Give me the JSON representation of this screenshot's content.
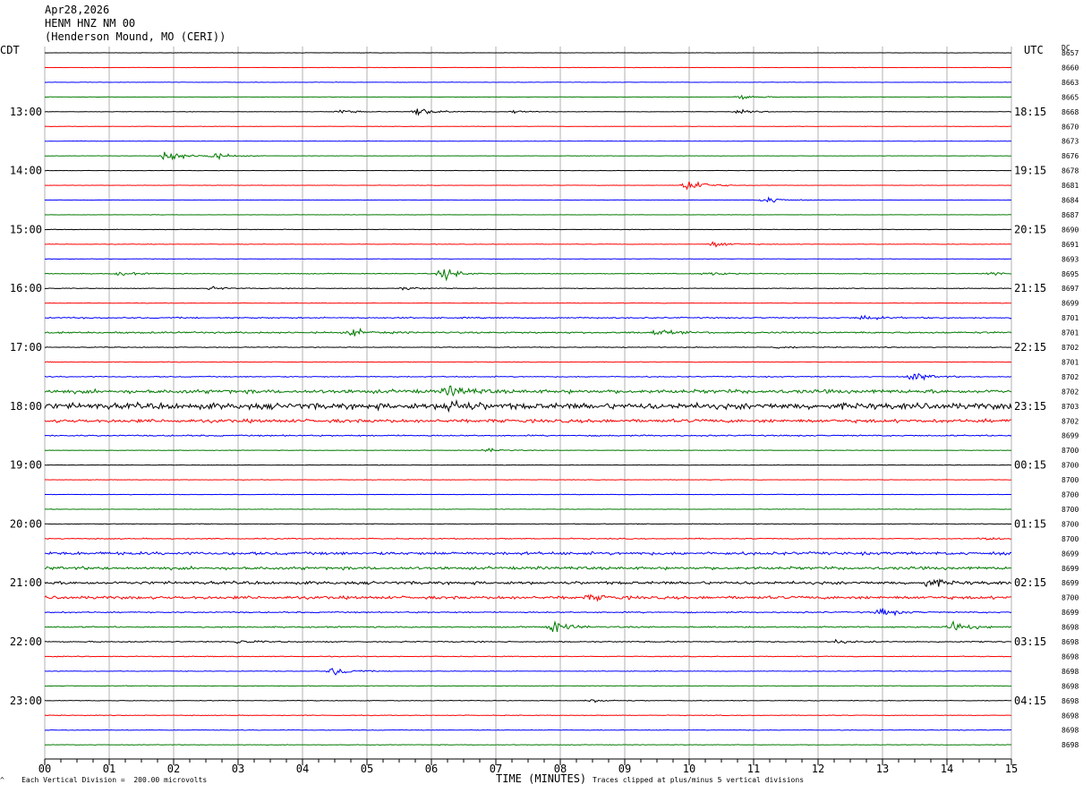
{
  "header": {
    "date": "Apr28,2026",
    "station": "HENM HNZ NM 00",
    "location": "(Henderson Mound, MO (CERI))"
  },
  "labels": {
    "left_tz": "CDT",
    "right_tz": "UTC",
    "dc": "DC"
  },
  "footer": {
    "scale_note": "Each Vertical Division =  200.00 microvolts",
    "clip_note": "Traces clipped at plus/minus 5 vertical divisions",
    "corner_mark": "^"
  },
  "colors": {
    "trace_cycle": [
      "#000000",
      "#ff0000",
      "#0000ff",
      "#007a00"
    ],
    "grid": "#b0b0b0"
  },
  "chart_data": {
    "type": "line",
    "xlabel": "TIME (MINUTES)",
    "x_ticks": [
      "00",
      "01",
      "02",
      "03",
      "04",
      "05",
      "06",
      "07",
      "08",
      "09",
      "10",
      "11",
      "12",
      "13",
      "14",
      "15"
    ],
    "xlim": [
      0,
      15
    ],
    "left_hour_labels": [
      "13:00",
      "14:00",
      "15:00",
      "16:00",
      "17:00",
      "18:00",
      "19:00",
      "20:00",
      "21:00",
      "22:00",
      "23:00"
    ],
    "right_hour_labels": [
      "18:15",
      "19:15",
      "20:15",
      "21:15",
      "22:15",
      "23:15",
      "00:15",
      "01:15",
      "02:15",
      "03:15",
      "04:15"
    ],
    "traces_per_hour": 4,
    "dc_offsets": [
      "8657",
      "8660",
      "8663",
      "8665",
      "8668",
      "8670",
      "8673",
      "8676",
      "8678",
      "8681",
      "8684",
      "8687",
      "8690",
      "8691",
      "8693",
      "8695",
      "8697",
      "8699",
      "8701",
      "8701",
      "8702",
      "8701",
      "8702",
      "8702",
      "8703",
      "8702",
      "8699",
      "8700",
      "8700",
      "8700",
      "8700",
      "8700",
      "8700",
      "8700",
      "8699",
      "8699",
      "8699",
      "8700",
      "8699",
      "8698",
      "8698",
      "8698",
      "8698",
      "8698",
      "8698",
      "8698",
      "8698",
      "8698"
    ],
    "noise_levels": [
      0.3,
      0.3,
      0.3,
      0.3,
      0.3,
      0.3,
      0.3,
      0.3,
      0.3,
      0.3,
      0.3,
      0.3,
      0.4,
      0.4,
      0.4,
      0.6,
      0.5,
      0.4,
      1.0,
      1.3,
      0.6,
      0.5,
      0.8,
      2.8,
      4.5,
      2.5,
      1.0,
      0.4,
      0.4,
      0.4,
      0.4,
      0.4,
      0.5,
      0.8,
      2.2,
      2.2,
      2.2,
      2.2,
      1.0,
      1.0,
      0.9,
      0.6,
      0.5,
      0.5,
      0.5,
      0.5,
      0.5,
      0.5
    ],
    "events": [
      {
        "trace": 3,
        "minute": 10.8,
        "amp": 4
      },
      {
        "trace": 4,
        "minute": 4.6,
        "amp": 3
      },
      {
        "trace": 4,
        "minute": 5.8,
        "amp": 8
      },
      {
        "trace": 4,
        "minute": 7.3,
        "amp": 2.5
      },
      {
        "trace": 4,
        "minute": 10.8,
        "amp": 2.5
      },
      {
        "trace": 7,
        "minute": 1.9,
        "amp": 10
      },
      {
        "trace": 7,
        "minute": 2.6,
        "amp": 6
      },
      {
        "trace": 9,
        "minute": 10.0,
        "amp": 12
      },
      {
        "trace": 10,
        "minute": 11.2,
        "amp": 6
      },
      {
        "trace": 13,
        "minute": 10.4,
        "amp": 5
      },
      {
        "trace": 15,
        "minute": 1.2,
        "amp": 3
      },
      {
        "trace": 15,
        "minute": 6.2,
        "amp": 9
      },
      {
        "trace": 15,
        "minute": 10.3,
        "amp": 3
      },
      {
        "trace": 15,
        "minute": 14.7,
        "amp": 3
      },
      {
        "trace": 16,
        "minute": 2.6,
        "amp": 2.5
      },
      {
        "trace": 16,
        "minute": 5.6,
        "amp": 2.5
      },
      {
        "trace": 18,
        "minute": 12.7,
        "amp": 4
      },
      {
        "trace": 19,
        "minute": 4.8,
        "amp": 5
      },
      {
        "trace": 19,
        "minute": 9.5,
        "amp": 4
      },
      {
        "trace": 20,
        "minute": 11.4,
        "amp": 2
      },
      {
        "trace": 22,
        "minute": 13.5,
        "amp": 6
      },
      {
        "trace": 23,
        "minute": 6.3,
        "amp": 8
      },
      {
        "trace": 24,
        "minute": 6.3,
        "amp": 10
      },
      {
        "trace": 27,
        "minute": 6.9,
        "amp": 3
      },
      {
        "trace": 33,
        "minute": 14.6,
        "amp": 2
      },
      {
        "trace": 36,
        "minute": 13.7,
        "amp": 6
      },
      {
        "trace": 37,
        "minute": 8.5,
        "amp": 4
      },
      {
        "trace": 38,
        "minute": 13.0,
        "amp": 6
      },
      {
        "trace": 39,
        "minute": 7.9,
        "amp": 9
      },
      {
        "trace": 39,
        "minute": 14.1,
        "amp": 8
      },
      {
        "trace": 40,
        "minute": 3.0,
        "amp": 3
      },
      {
        "trace": 40,
        "minute": 12.3,
        "amp": 2.5
      },
      {
        "trace": 42,
        "minute": 4.5,
        "amp": 7
      },
      {
        "trace": 44,
        "minute": 8.5,
        "amp": 3
      }
    ]
  }
}
